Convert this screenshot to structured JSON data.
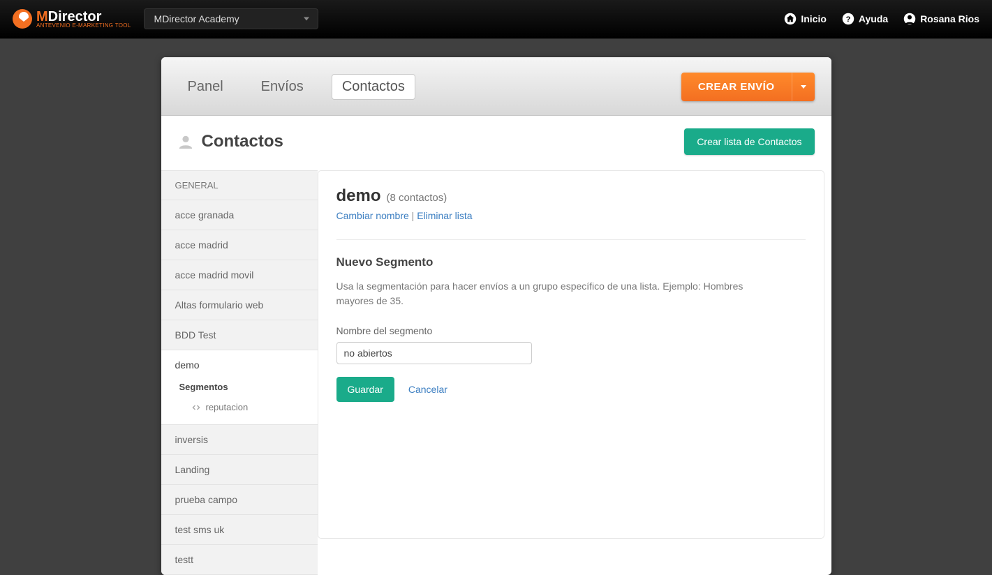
{
  "topbar": {
    "brand_primary": "MDirector",
    "brand_tagline": "ANTEVENIO E-MARKETING TOOL",
    "account_selected": "MDirector Academy",
    "links": {
      "home": "Inicio",
      "help": "Ayuda",
      "user": "Rosana Rios"
    }
  },
  "nav": {
    "tabs": [
      "Panel",
      "Envíos",
      "Contactos"
    ],
    "active_index": 2,
    "create_button": "CREAR ENVÍO"
  },
  "title_row": {
    "title": "Contactos",
    "create_list_button": "Crear lista de Contactos"
  },
  "sidebar": {
    "header": "GENERAL",
    "items": [
      "acce granada",
      "acce madrid",
      "acce madrid movil",
      "Altas formulario web",
      "BDD Test",
      "demo",
      "inversis",
      "Landing",
      "prueba campo",
      "test sms uk",
      "testt"
    ],
    "active_index": 5,
    "segments_label": "Segmentos",
    "segments": [
      "reputacion"
    ]
  },
  "content": {
    "list_name": "demo",
    "list_count_text": "(8 contactos)",
    "rename_link": "Cambiar nombre",
    "delete_link": "Eliminar lista",
    "separator": " | ",
    "segment_section_title": "Nuevo Segmento",
    "segment_section_desc": "Usa la segmentación para hacer envíos a un grupo específico de una lista. Ejemplo: Hombres mayores de 35.",
    "segment_name_label": "Nombre del segmento",
    "segment_name_value": "no abiertos",
    "save_button": "Guardar",
    "cancel_link": "Cancelar"
  }
}
